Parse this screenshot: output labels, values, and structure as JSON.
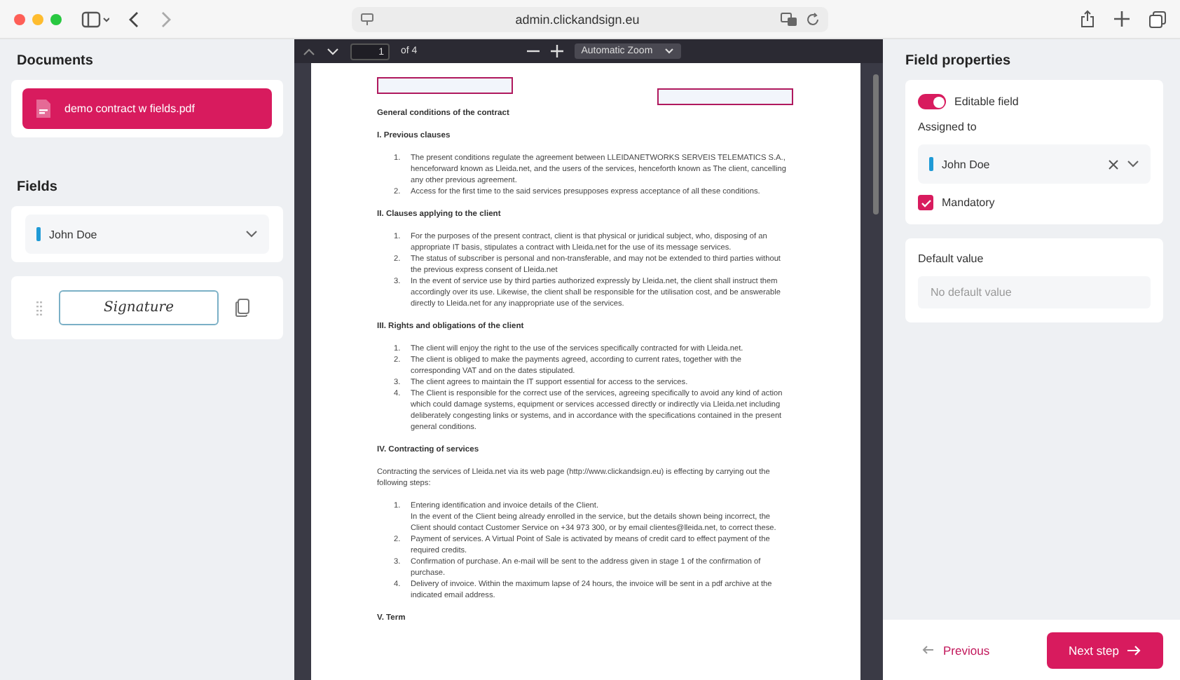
{
  "browser": {
    "url": "admin.clickandsign.eu"
  },
  "left": {
    "documents_title": "Documents",
    "documents": [
      {
        "name": "demo contract w fields.pdf",
        "selected": true
      }
    ],
    "fields_title": "Fields",
    "signer": {
      "name": "John Doe",
      "color": "#1f9ad6"
    },
    "fields": [
      {
        "label": "Signature"
      }
    ]
  },
  "viewer": {
    "page": "1",
    "page_count": "of 4",
    "zoom": "Automatic Zoom"
  },
  "document": {
    "title": "General conditions of the contract",
    "sections": [
      {
        "heading": "I. Previous clauses",
        "items": [
          {
            "number": "1.",
            "text": "The present conditions regulate the agreement between LLEIDANETWORKS SERVEIS TELEMATICS S.A., henceforward known as Lleida.net, and the users of the services, henceforth known as The client, cancelling any other previous agreement."
          },
          {
            "number": "2.",
            "text": "Access for the first time to the said services presupposes express acceptance of all these conditions."
          }
        ]
      },
      {
        "heading": "II. Clauses applying to the client",
        "items": [
          {
            "number": "1.",
            "text": "For the purposes of the present contract, client is that physical or juridical subject, who, disposing of an appropriate IT basis, stipulates a contract with Lleida.net for the use of its message services."
          },
          {
            "number": "2.",
            "text": "The status of subscriber is personal and non-transferable, and may not be extended to third parties without the previous express consent of Lleida.net"
          },
          {
            "number": "3.",
            "text": "In the event of service use by third parties authorized expressly by Lleida.net, the client shall instruct them accordingly over its use. Likewise, the client shall be responsible for the utilisation cost, and be answerable directly to Lleida.net for any inappropriate use of the services."
          }
        ]
      },
      {
        "heading": "III. Rights and obligations of the client",
        "items": [
          {
            "number": "1.",
            "text": "The client will enjoy the right to the use of the services specifically contracted for with Lleida.net."
          },
          {
            "number": "2.",
            "text": "The client is obliged to make the payments agreed, according to current rates, together with the corresponding VAT and on the dates stipulated."
          },
          {
            "number": "3.",
            "text": "The client agrees to maintain the IT support essential for access to the services."
          },
          {
            "number": "4.",
            "text": "The Client is responsible for the correct use of the services, agreeing specifically to avoid any kind of action which could damage systems, equipment or services accessed directly or indirectly via Lleida.net including deliberately congesting links or systems, and in accordance with the specifications contained in the present general conditions."
          }
        ]
      },
      {
        "heading": "IV. Contracting of services",
        "intro": "Contracting the services of Lleida.net via its web page (http://www.clickandsign.eu) is effecting by carrying out the following steps:",
        "items": [
          {
            "number": "1.",
            "text": "Entering identification and invoice details of the Client.",
            "note": "In the event of the Client being already enrolled in the service, but the details shown being incorrect, the Client should contact Customer Service on +34 973 300, or by email clientes@lleida.net, to correct these."
          },
          {
            "number": "2.",
            "text": "Payment of services. A Virtual Point of Sale is activated by means of credit card to effect payment of the required credits."
          },
          {
            "number": "3.",
            "text": "Confirmation of purchase. An e-mail will be sent to the address given in stage 1 of the confirmation of purchase."
          },
          {
            "number": "4.",
            "text": "Delivery of invoice. Within the maximum lapse of 24 hours, the invoice will be sent in a pdf archive at the indicated email address."
          }
        ]
      },
      {
        "heading": "V. Term"
      }
    ]
  },
  "right": {
    "title": "Field properties",
    "editable": {
      "label": "Editable field",
      "on": true
    },
    "assigned_label": "Assigned to",
    "assigned": {
      "name": "John Doe",
      "color": "#1f9ad6"
    },
    "mandatory": {
      "label": "Mandatory",
      "checked": true
    },
    "default_title": "Default value",
    "default_placeholder": "No default value",
    "previous": "Previous",
    "next": "Next step"
  }
}
